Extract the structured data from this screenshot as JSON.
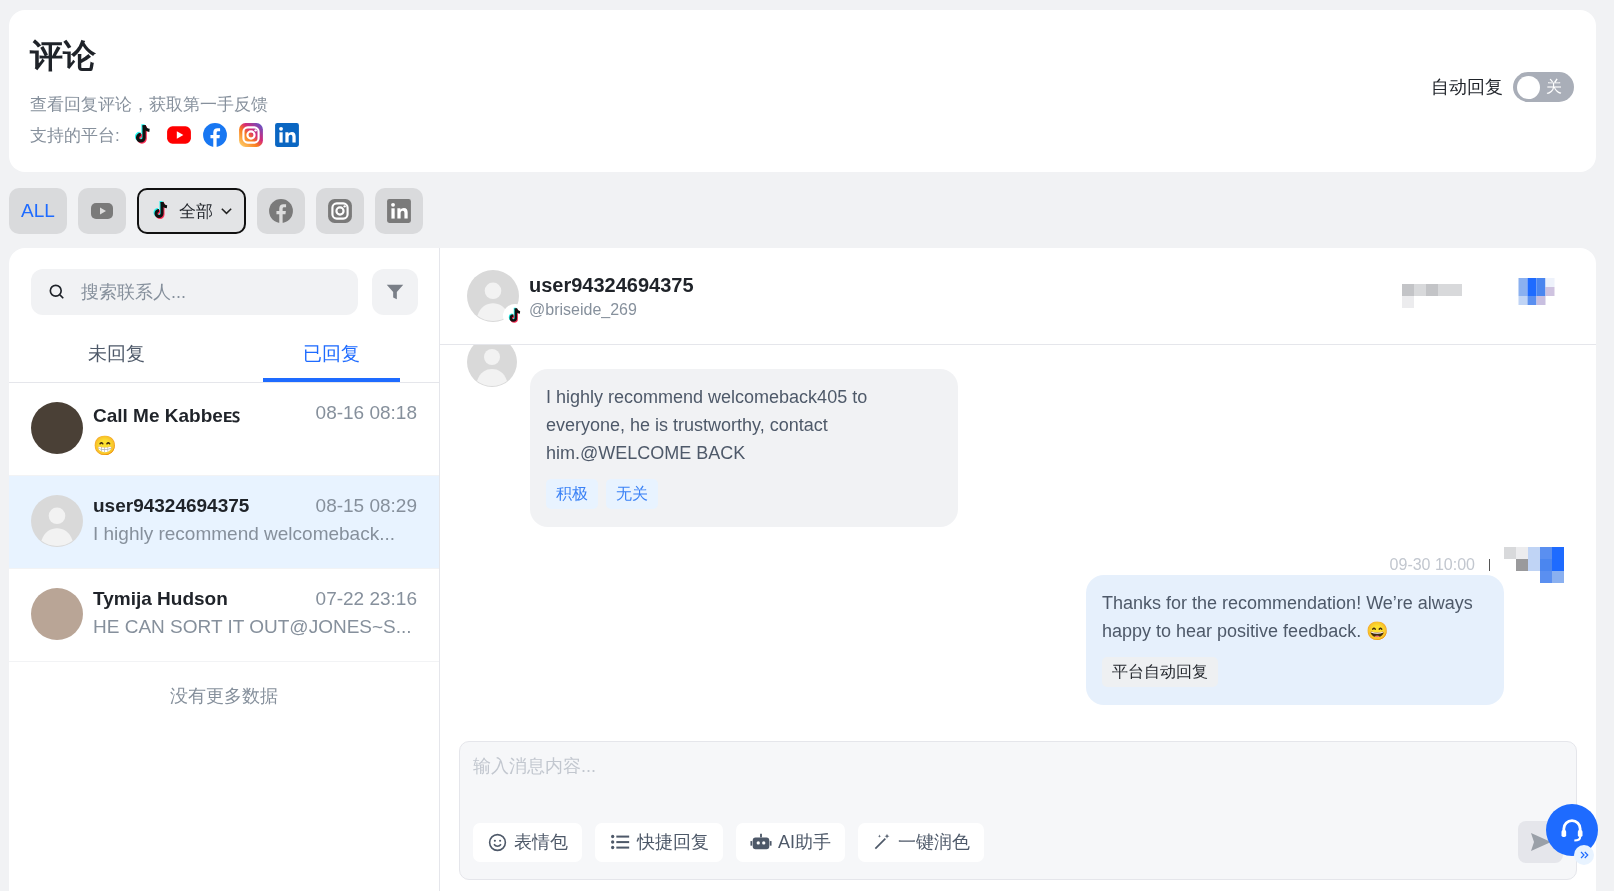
{
  "header": {
    "title": "评论",
    "subtitle": "查看回复评论，获取第一手反馈",
    "platforms_label": "支持的平台:",
    "auto_reply": {
      "label": "自动回复",
      "on": false,
      "state_text": "关"
    }
  },
  "platform_filters": [
    {
      "kind": "all",
      "label": "ALL",
      "selected": false
    },
    {
      "kind": "youtube",
      "selected": false
    },
    {
      "kind": "tiktok",
      "label": "全部",
      "selected": true
    },
    {
      "kind": "facebook",
      "selected": false
    },
    {
      "kind": "instagram",
      "selected": false
    },
    {
      "kind": "linkedin",
      "selected": false
    }
  ],
  "contacts_panel": {
    "search": {
      "placeholder": "搜索联系人..."
    },
    "tabs": [
      {
        "label": "未回复",
        "selected": false
      },
      {
        "label": "已回复",
        "selected": true
      }
    ],
    "contacts": [
      {
        "name": "Call Me Kabbeᴇꜱ",
        "time": "08-16 08:18",
        "preview": "😁",
        "kind": "photo",
        "selected": false
      },
      {
        "name": "user94324694375",
        "time": "08-15 08:29",
        "preview": "I highly recommend welcomeback...",
        "kind": "default",
        "selected": true
      },
      {
        "name": "Tymija Hudson",
        "time": "07-22 23:16",
        "preview": "HE CAN SORT IT OUT@JONES~S...",
        "kind": "photo",
        "selected": false
      }
    ],
    "footer": "没有更多数据"
  },
  "chat": {
    "contact": {
      "name": "user94324694375",
      "handle": "@briseide_269"
    },
    "messages": [
      {
        "kind": "incoming",
        "text": "I highly recommend welcomeback405 to everyone, he is trustworthy, contact him.@WELCOME BACK",
        "tags": [
          "积极",
          "无关"
        ]
      },
      {
        "kind": "outgoing",
        "time": "09-30 10:00",
        "text": "Thanks for the recommendation! We’re always happy to hear positive feedback. 😄",
        "tags": [
          "平台自动回复"
        ]
      }
    ],
    "composer": {
      "placeholder": "输入消息内容...",
      "tools": [
        {
          "kind": "emoji",
          "label": "表情包"
        },
        {
          "kind": "list",
          "label": "快捷回复"
        },
        {
          "kind": "robot",
          "label": "AI助手"
        },
        {
          "kind": "wand",
          "label": "一键润色"
        }
      ]
    }
  }
}
